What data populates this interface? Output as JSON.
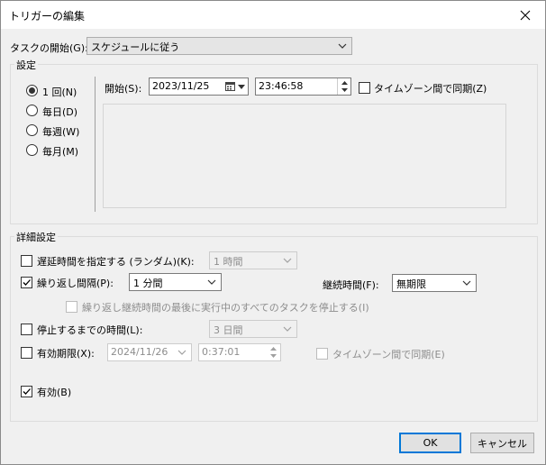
{
  "window": {
    "title": "トリガーの編集"
  },
  "begin_task": {
    "label": "タスクの開始(G):",
    "value": "スケジュールに従う"
  },
  "settings": {
    "group_label": "設定",
    "radios": [
      {
        "label": "1 回(N)",
        "checked": true
      },
      {
        "label": "毎日(D)",
        "checked": false
      },
      {
        "label": "毎週(W)",
        "checked": false
      },
      {
        "label": "毎月(M)",
        "checked": false
      }
    ],
    "start_label": "開始(S):",
    "start_date": "2023/11/25",
    "start_time": "23:46:58",
    "sync_tz_label": "タイムゾーン間で同期(Z)"
  },
  "advanced": {
    "group_label": "詳細設定",
    "delay": {
      "label": "遅延時間を指定する (ランダム)(K):",
      "value": "1 時間",
      "checked": false
    },
    "repeat": {
      "label": "繰り返し間隔(P):",
      "value": "1 分間",
      "checked": true
    },
    "duration": {
      "label": "継続時間(F):",
      "value": "無期限"
    },
    "stop_all": {
      "label": "繰り返し継続時間の最後に実行中のすべてのタスクを停止する(I)",
      "checked": false
    },
    "stop_after": {
      "label": "停止するまでの時間(L):",
      "value": "3 日間",
      "checked": false
    },
    "expire": {
      "label": "有効期限(X):",
      "date": "2024/11/26",
      "time": "0:37:01",
      "checked": false
    },
    "expire_sync_tz": {
      "label": "タイムゾーン間で同期(E)",
      "checked": false
    },
    "enabled": {
      "label": "有効(B)",
      "checked": true
    }
  },
  "buttons": {
    "ok": "OK",
    "cancel": "キャンセル"
  }
}
